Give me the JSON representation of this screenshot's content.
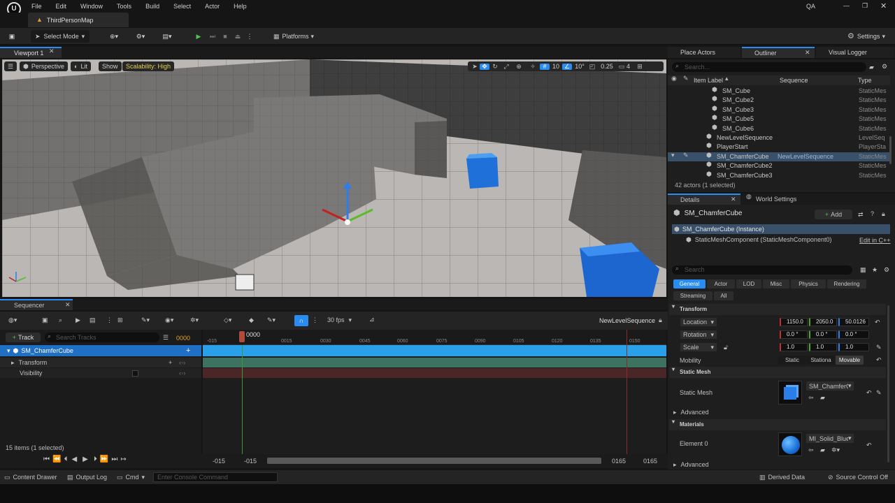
{
  "menu": [
    "File",
    "Edit",
    "Window",
    "Tools",
    "Build",
    "Select",
    "Actor",
    "Help"
  ],
  "user_badge": "QA",
  "map_tab": "ThirdPersonMap",
  "toolbar": {
    "select_mode": "Select Mode",
    "platforms": "Platforms",
    "settings": "Settings"
  },
  "viewport": {
    "tab": "Viewport 1",
    "perspective": "Perspective",
    "lit": "Lit",
    "show": "Show",
    "scalability": "Scalability: High",
    "grid_snap": "10",
    "rot_snap": "10°",
    "scale_snap": "0.25",
    "camera_speed": "4"
  },
  "right_tabs": {
    "place_actors": "Place Actors",
    "outliner": "Outliner",
    "visual_logger": "Visual Logger"
  },
  "outliner": {
    "search_placeholder": "Search...",
    "col_label": "Item Label",
    "col_sequence": "Sequence",
    "col_type": "Type",
    "rows": [
      {
        "label": "SM_Cube",
        "sequence": "",
        "type": "StaticMes",
        "indent": 2
      },
      {
        "label": "SM_Cube2",
        "sequence": "",
        "type": "StaticMes",
        "indent": 2
      },
      {
        "label": "SM_Cube3",
        "sequence": "",
        "type": "StaticMes",
        "indent": 2
      },
      {
        "label": "SM_Cube5",
        "sequence": "",
        "type": "StaticMes",
        "indent": 2
      },
      {
        "label": "SM_Cube6",
        "sequence": "",
        "type": "StaticMes",
        "indent": 2
      },
      {
        "label": "NewLevelSequence",
        "sequence": "",
        "type": "LevelSeq",
        "indent": 1
      },
      {
        "label": "PlayerStart",
        "sequence": "",
        "type": "PlayerSta",
        "indent": 1
      },
      {
        "label": "SM_ChamferCube",
        "sequence": "NewLevelSequence",
        "type": "StaticMes",
        "indent": 1,
        "selected": true
      },
      {
        "label": "SM_ChamferCube2",
        "sequence": "",
        "type": "StaticMes",
        "indent": 1
      },
      {
        "label": "SM_ChamferCube3",
        "sequence": "",
        "type": "StaticMes",
        "indent": 1
      }
    ],
    "actor_count": "42 actors (1 selected)"
  },
  "details": {
    "tab": "Details",
    "world_settings": "World Settings",
    "actor_name": "SM_ChamferCube",
    "add": "Add",
    "instance": "SM_ChamferCube (Instance)",
    "component": "StaticMeshComponent (StaticMeshComponent0)",
    "edit_cpp": "Edit in C++",
    "search_placeholder": "Search",
    "filters": [
      "General",
      "Actor",
      "LOD",
      "Misc",
      "Physics",
      "Rendering",
      "Streaming",
      "All"
    ],
    "transform_header": "Transform",
    "location_label": "Location",
    "location": [
      "1150.0",
      "2050.0",
      "50.0126"
    ],
    "rotation_label": "Rotation",
    "rotation": [
      "0.0 °",
      "0.0 °",
      "0.0 °"
    ],
    "scale_label": "Scale",
    "scale": [
      "1.0",
      "1.0",
      "1.0"
    ],
    "mobility_label": "Mobility",
    "mobility": [
      "Static",
      "Stationa",
      "Movable"
    ],
    "static_mesh_header": "Static Mesh",
    "static_mesh_label": "Static Mesh",
    "static_mesh_value": "SM_ChamferCube",
    "advanced": "Advanced",
    "materials_header": "Materials",
    "element0_label": "Element 0",
    "material_value": "MI_Solid_Blue",
    "advanced2": "Advanced"
  },
  "sequencer": {
    "tab": "Sequencer",
    "add_track": "Track",
    "search_placeholder": "Search Tracks",
    "current_frame": "0000",
    "fps": "30 fps",
    "sequence_name": "NewLevelSequence",
    "tracks": [
      {
        "label": "SM_ChamferCube",
        "level": 0
      },
      {
        "label": "Transform",
        "level": 1
      },
      {
        "label": "Visibility",
        "level": 1
      }
    ],
    "ruler": [
      "-015",
      "0015",
      "0030",
      "0045",
      "0060",
      "0075",
      "0090",
      "0105",
      "0120",
      "0135",
      "0150"
    ],
    "playhead_label": "0000",
    "items_count": "15 items (1 selected)",
    "range_start_a": "-015",
    "range_start_b": "-015",
    "range_end_a": "0165",
    "range_end_b": "0165"
  },
  "status": {
    "content_drawer": "Content Drawer",
    "output_log": "Output Log",
    "cmd": "Cmd",
    "console_placeholder": "Enter Console Command",
    "derived_data": "Derived Data",
    "source_control": "Source Control Off"
  }
}
